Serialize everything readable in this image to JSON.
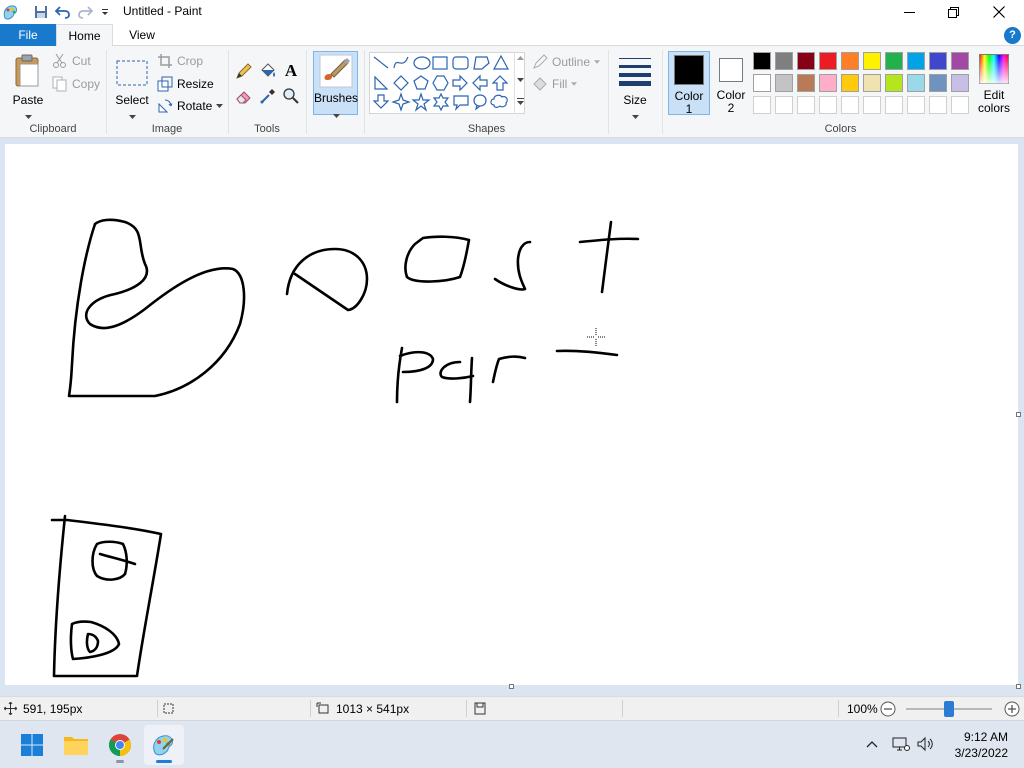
{
  "window": {
    "title": "Untitled - Paint"
  },
  "tabs": {
    "file": "File",
    "home": "Home",
    "view": "View"
  },
  "ribbon": {
    "clipboard": {
      "paste": "Paste",
      "cut": "Cut",
      "copy": "Copy",
      "label": "Clipboard"
    },
    "image": {
      "select": "Select",
      "crop": "Crop",
      "resize": "Resize",
      "rotate": "Rotate",
      "label": "Image"
    },
    "tools": {
      "label": "Tools"
    },
    "brushes": {
      "label": "Brushes"
    },
    "shapes": {
      "outline": "Outline",
      "fill": "Fill",
      "label": "Shapes"
    },
    "size": {
      "label": "Size"
    },
    "colors": {
      "color1_line1": "Color",
      "color1_line2": "1",
      "color2_line1": "Color",
      "color2_line2": "2",
      "edit_line1": "Edit",
      "edit_line2": "colors",
      "label": "Colors",
      "color1_value": "#000000",
      "color2_value": "#ffffff",
      "palette_row1": [
        "#000000",
        "#7f7f7f",
        "#880015",
        "#ed1c24",
        "#ff7f27",
        "#fff200",
        "#22b14c",
        "#00a2e8",
        "#3f48cc",
        "#a349a4"
      ],
      "palette_row2": [
        "#ffffff",
        "#c3c3c3",
        "#b97a57",
        "#ffaec9",
        "#ffc90e",
        "#efe4b0",
        "#b5e61d",
        "#99d9ea",
        "#7092be",
        "#c8bfe7"
      ]
    }
  },
  "status": {
    "cursor_pos": "591, 195px",
    "canvas_size": "1013 × 541px",
    "zoom": "100%",
    "zoom_level": 1.0
  },
  "taskbar": {
    "time": "9:12 AM",
    "date": "3/23/2022"
  }
}
